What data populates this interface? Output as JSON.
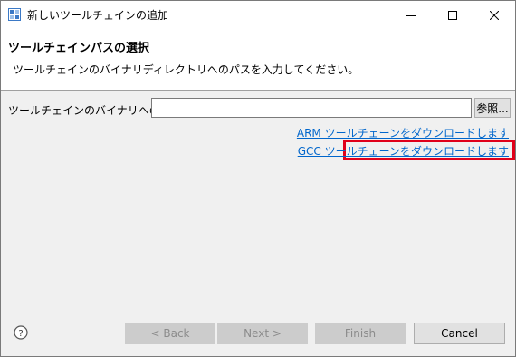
{
  "window": {
    "title": "新しいツールチェインの追加"
  },
  "header": {
    "title": "ツールチェインパスの選択",
    "description": "ツールチェインのバイナリディレクトリへのパスを入力してください。"
  },
  "form": {
    "path_label": "ツールチェインのバイナリへのパス:",
    "path_value": "",
    "browse_label": "参照..."
  },
  "links": {
    "arm_download": "ARM ツールチェーンをダウンロードします",
    "gcc_download": "GCC ツールチェーンをダウンロードします"
  },
  "footer": {
    "back_label": "< Back",
    "next_label": "Next >",
    "finish_label": "Finish",
    "cancel_label": "Cancel"
  },
  "colors": {
    "link": "#0066cc",
    "highlight": "#e0001a",
    "disabled_button": "#cccccc"
  }
}
